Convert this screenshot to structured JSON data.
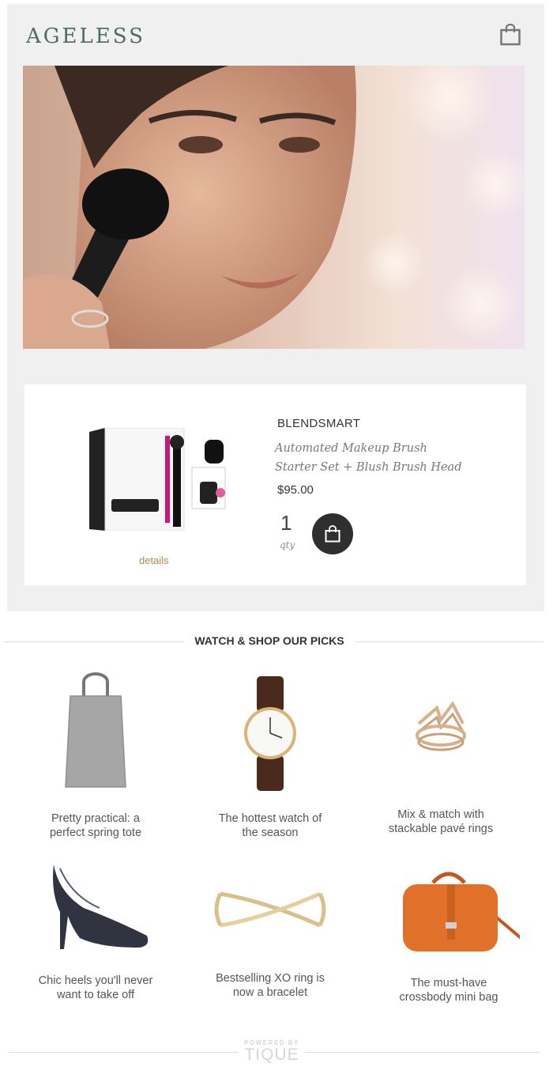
{
  "header": {
    "logo": "AGELESS",
    "cart_icon": "shopping-bag-icon"
  },
  "hero": {
    "image": "woman-applying-blush-video-still"
  },
  "product": {
    "brand": "BLENDSMART",
    "name_line1": "Automated Makeup Brush",
    "name_line2": "Starter Set + Blush Brush Head",
    "price": "$95.00",
    "qty": "1",
    "qty_label": "qty",
    "details_label": "details",
    "add_icon": "shopping-bag-icon"
  },
  "picks": {
    "title": "WATCH & SHOP OUR  PICKS",
    "items": [
      {
        "line1": "Pretty practical: a",
        "line2": "perfect spring tote"
      },
      {
        "line1": "The hottest watch of",
        "line2": "the season"
      },
      {
        "line1": "Mix & match with",
        "line2": "stackable pavé rings"
      },
      {
        "line1": "Chic heels you'll never",
        "line2": "want to take off"
      },
      {
        "line1": "Bestselling XO ring is",
        "line2": "now a bracelet"
      },
      {
        "line1": "The must-have",
        "line2": "crossbody mini bag"
      }
    ]
  },
  "footer": {
    "powered_by": "POWERED BY",
    "brand": "TIQUE"
  },
  "colors": {
    "logo": "#4f6a66",
    "accent_link": "#b08a4a",
    "button": "#2f2f2f"
  }
}
